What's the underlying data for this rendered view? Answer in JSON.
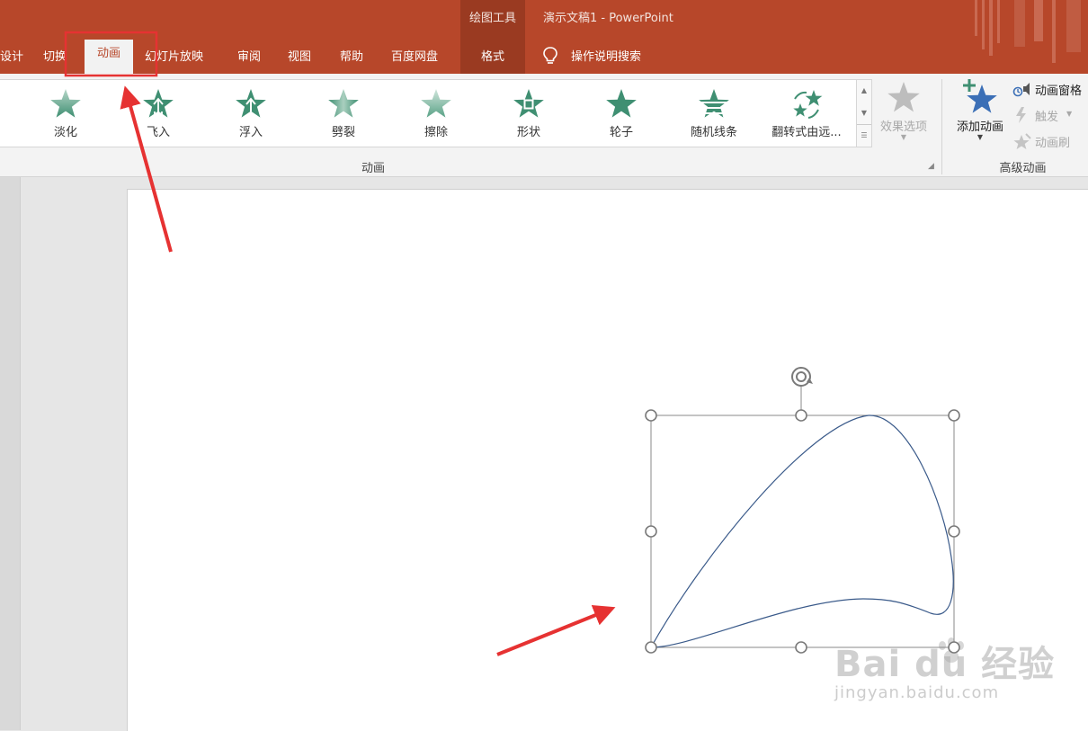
{
  "window": {
    "context_tools": "绘图工具",
    "title": "演示文稿1  -  PowerPoint"
  },
  "tabs": {
    "design_partial": "设计",
    "transitions": "切换",
    "animations": "动画",
    "slideshow": "幻灯片放映",
    "review": "审阅",
    "view": "视图",
    "help": "帮助",
    "baidu_netdisk": "百度网盘",
    "format": "格式"
  },
  "search": {
    "label": "操作说明搜索"
  },
  "animation_gallery": {
    "items": [
      {
        "label": "淡化",
        "icon": "fade-star-icon"
      },
      {
        "label": "飞入",
        "icon": "fly-in-star-icon"
      },
      {
        "label": "浮入",
        "icon": "float-in-star-icon"
      },
      {
        "label": "劈裂",
        "icon": "split-star-icon"
      },
      {
        "label": "擦除",
        "icon": "wipe-star-icon"
      },
      {
        "label": "形状",
        "icon": "shape-star-icon"
      },
      {
        "label": "轮子",
        "icon": "wheel-star-icon"
      },
      {
        "label": "随机线条",
        "icon": "random-bars-star-icon"
      },
      {
        "label": "翻转式由远...",
        "icon": "grow-turn-stars-icon"
      }
    ],
    "group_label": "动画"
  },
  "effect_options": {
    "label": "效果选项"
  },
  "advanced": {
    "add_animation": "添加动画",
    "animation_pane": "动画窗格",
    "trigger": "触发",
    "animation_painter": "动画刷",
    "group_label": "高级动画"
  },
  "watermark": {
    "brand": "Bai du 经验",
    "url": "jingyan.baidu.com"
  },
  "colors": {
    "ribbon_brand": "#b7472a",
    "context_tab": "#9a3a21",
    "star_green": "#3f8f72",
    "add_star_blue": "#3b6fb6",
    "annotation_red": "#e63232",
    "curve_stroke": "#3a5a8a"
  }
}
